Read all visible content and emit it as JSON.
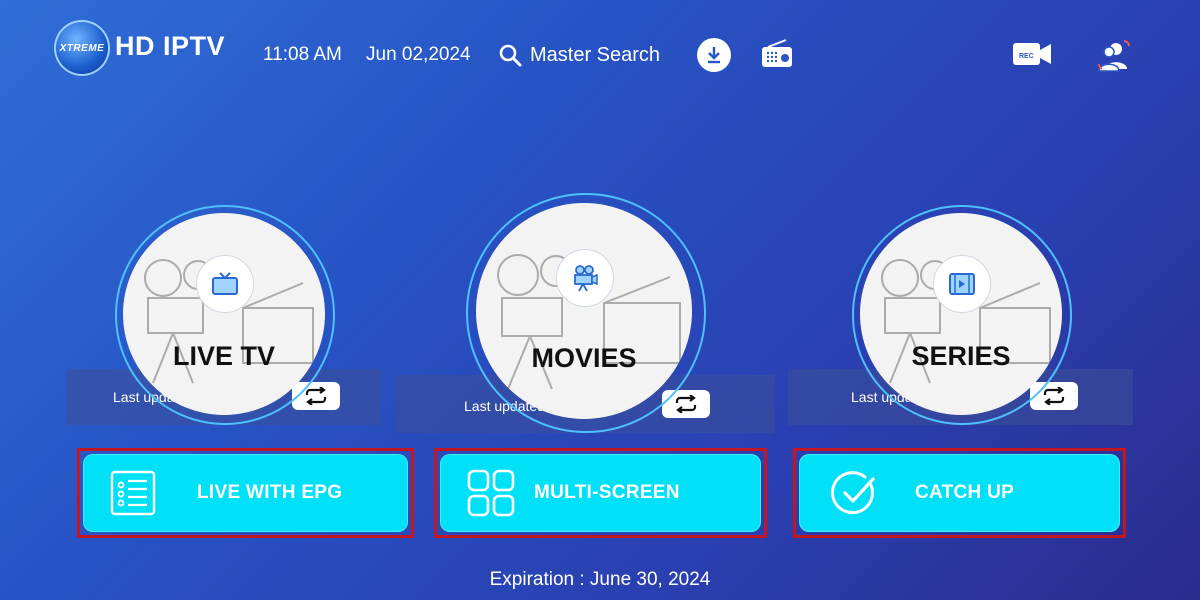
{
  "header": {
    "logo_text": "XTREME",
    "app_title": "HD IPTV",
    "time": "11:08 AM",
    "date": "Jun 02,2024",
    "search_label": "Master Search",
    "icons": [
      "download-icon",
      "radio-icon",
      "rec-camera-icon",
      "switch-user-icon"
    ],
    "rec_badge": "REC"
  },
  "categories": [
    {
      "label": "LIVE TV",
      "updated": "Last updated: 1 sec ago",
      "icon": "tv-icon"
    },
    {
      "label": "MOVIES",
      "updated": "Last updated: 1 sec ago",
      "icon": "projector-icon"
    },
    {
      "label": "SERIES",
      "updated": "Last updated: 1 sec ago",
      "icon": "film-icon"
    }
  ],
  "actions": [
    {
      "label": "LIVE WITH EPG",
      "icon": "list-icon"
    },
    {
      "label": "MULTI-SCREEN",
      "icon": "grid-icon"
    },
    {
      "label": "CATCH UP",
      "icon": "check-circle-icon"
    }
  ],
  "footer": {
    "expiration": "Expiration : June 30, 2024"
  },
  "colors": {
    "accent_cyan": "#00e0f7",
    "highlight_red": "#c01722",
    "ring_blue": "#4fc0ff"
  }
}
